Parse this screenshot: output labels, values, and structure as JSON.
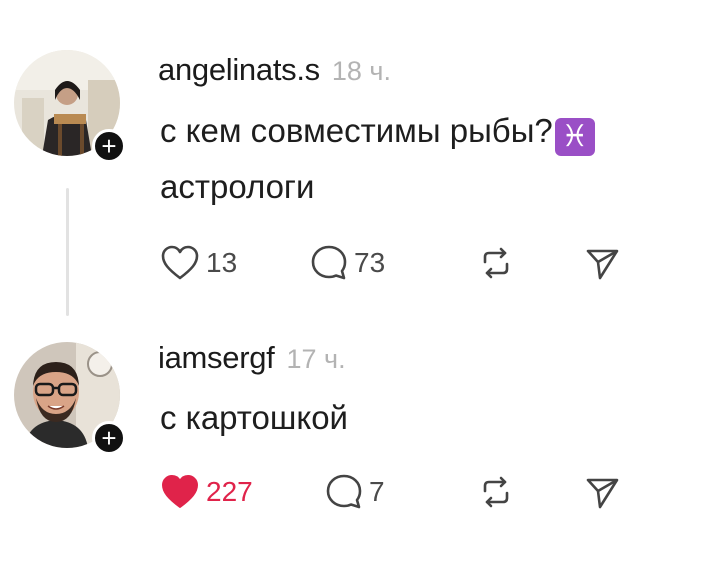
{
  "posts": [
    {
      "username": "angelinats.s",
      "time": "18 ч.",
      "text_line1": "с кем совместимы рыбы?",
      "emoji": "♓",
      "text_line2": "астрологи",
      "likes": "13",
      "replies": "73",
      "liked": false
    },
    {
      "username": "iamsergf",
      "time": "17 ч.",
      "text_line1": "с картошкой",
      "likes": "227",
      "replies": "7",
      "liked": true
    }
  ],
  "colors": {
    "liked_heart": "#e0234a",
    "follow_badge": "#111111",
    "pisces_bg": "#9a4fc6",
    "muted_text": "#b3b3b3"
  },
  "icons": {
    "like": "heart-icon",
    "reply": "speech-bubble-icon",
    "repost": "repost-icon",
    "share": "paper-plane-icon",
    "follow": "plus-icon"
  },
  "follow_badge_symbol": "+"
}
